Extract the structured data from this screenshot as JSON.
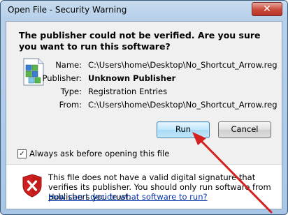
{
  "window": {
    "title": "Open File - Security Warning",
    "close_glyph": "✕"
  },
  "heading": "The publisher could not be verified.  Are you sure you want to run this software?",
  "details": [
    {
      "label": "Name:",
      "value": "C:\\Users\\home\\Desktop\\No_Shortcut_Arrow.reg",
      "bold": false
    },
    {
      "label": "Publisher:",
      "value": "Unknown Publisher",
      "bold": true
    },
    {
      "label": "Type:",
      "value": "Registration Entries",
      "bold": false
    },
    {
      "label": "From:",
      "value": "C:\\Users\\home\\Desktop\\No_Shortcut_Arrow.reg",
      "bold": false
    }
  ],
  "buttons": {
    "run": "Run",
    "cancel": "Cancel"
  },
  "checkbox": {
    "label": "Always ask before opening this file",
    "checked": true,
    "mark": "✓"
  },
  "warning": {
    "text": "This file does not have a valid digital signature that verifies its publisher.  You should only run software from publishers you trust.",
    "link": "How can I decide what software to run?"
  },
  "icons": {
    "file": "registry-file-icon",
    "warning": "security-shield-x-icon"
  },
  "colors": {
    "annotation_arrow": "#d42020",
    "link": "#0033aa"
  }
}
